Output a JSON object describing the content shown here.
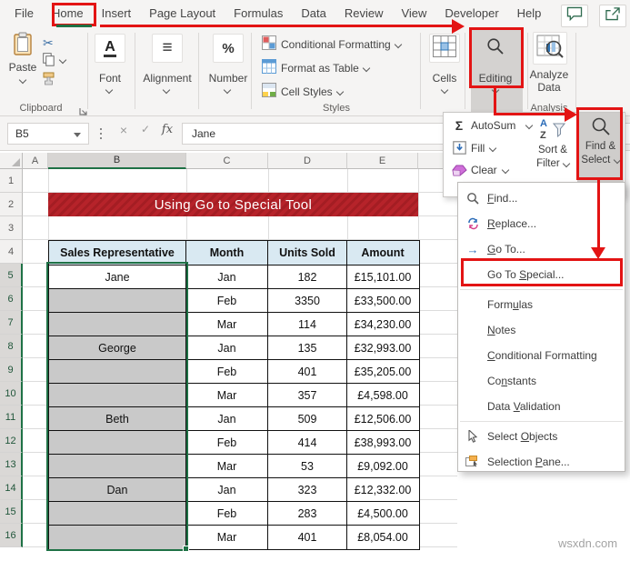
{
  "window": {
    "watermark": "wsxdn.com"
  },
  "tabs": {
    "items": [
      "File",
      "Home",
      "Insert",
      "Page Layout",
      "Formulas",
      "Data",
      "Review",
      "View",
      "Developer",
      "Help"
    ],
    "active": "Home"
  },
  "ribbon": {
    "clipboard": {
      "paste": "Paste",
      "label": "Clipboard"
    },
    "font": {
      "icon_letter": "A",
      "label": "Font"
    },
    "alignment": {
      "icon": "≡",
      "label": "Alignment"
    },
    "number": {
      "icon": "%",
      "label": "Number"
    },
    "styles": {
      "conditional": "Conditional Formatting",
      "format_table": "Format as Table",
      "cell_styles": "Cell Styles",
      "label": "Styles"
    },
    "cells": {
      "label": "Cells"
    },
    "editing": {
      "label": "Editing"
    },
    "analyze": {
      "line1": "Analyze",
      "line2": "Data",
      "group": "Analysis"
    }
  },
  "formula_bar": {
    "name_box": "B5",
    "cancel": "×",
    "enter": "✓",
    "fx": "fx",
    "value": "Jane"
  },
  "flyout": {
    "autosum": {
      "icon": "Σ",
      "label": "AutoSum"
    },
    "fill": {
      "label": "Fill"
    },
    "clear": {
      "label": "Clear"
    },
    "sort_filter": {
      "icon_a": "A",
      "icon_z": "Z",
      "line1": "Sort &",
      "line2": "Filter"
    },
    "find_select": {
      "line1": "Find &",
      "line2": "Select"
    }
  },
  "menu": {
    "items": [
      {
        "pre": "",
        "accel": "F",
        "post": "ind...",
        "icon": "find"
      },
      {
        "pre": "",
        "accel": "R",
        "post": "eplace...",
        "icon": "replace"
      },
      {
        "pre": "",
        "accel": "G",
        "post": "o To...",
        "icon": "goto"
      },
      {
        "pre": "Go To ",
        "accel": "S",
        "post": "pecial...",
        "icon": "",
        "highlight": true
      },
      {
        "sep": true
      },
      {
        "pre": "Form",
        "accel": "u",
        "post": "las",
        "icon": ""
      },
      {
        "pre": "",
        "accel": "N",
        "post": "otes",
        "icon": ""
      },
      {
        "pre": "",
        "accel": "C",
        "post": "onditional Formatting",
        "icon": ""
      },
      {
        "pre": "Co",
        "accel": "n",
        "post": "stants",
        "icon": ""
      },
      {
        "pre": "Data ",
        "accel": "V",
        "post": "alidation",
        "icon": ""
      },
      {
        "sep": true
      },
      {
        "pre": "Select ",
        "accel": "O",
        "post": "bjects",
        "icon": "cursor"
      },
      {
        "pre": "Selection ",
        "accel": "P",
        "post": "ane...",
        "icon": "pane"
      }
    ]
  },
  "sheet": {
    "columns": [
      "A",
      "B",
      "C",
      "D",
      "E"
    ],
    "rows": [
      "1",
      "2",
      "3",
      "4",
      "5",
      "6",
      "7",
      "8",
      "9",
      "10",
      "11",
      "12",
      "13",
      "14",
      "15",
      "16"
    ],
    "banner": "Using Go to Special Tool",
    "active_cell": "B5",
    "table": {
      "headers": [
        "Sales Representative",
        "Month",
        "Units Sold",
        "Amount"
      ],
      "rows": [
        [
          "Jane",
          "Jan",
          "182",
          "£15,101.00"
        ],
        [
          "",
          "Feb",
          "3350",
          "£33,500.00"
        ],
        [
          "",
          "Mar",
          "114",
          "£34,230.00"
        ],
        [
          "George",
          "Jan",
          "135",
          "£32,993.00"
        ],
        [
          "",
          "Feb",
          "401",
          "£35,205.00"
        ],
        [
          "",
          "Mar",
          "357",
          "£4,598.00"
        ],
        [
          "Beth",
          "Jan",
          "509",
          "£12,506.00"
        ],
        [
          "",
          "Feb",
          "414",
          "£38,993.00"
        ],
        [
          "",
          "Mar",
          "53",
          "£9,092.00"
        ],
        [
          "Dan",
          "Jan",
          "323",
          "£12,332.00"
        ],
        [
          "",
          "Feb",
          "283",
          "£4,500.00"
        ],
        [
          "",
          "Mar",
          "401",
          "£8,054.00"
        ]
      ]
    }
  },
  "colors": {
    "annotation_red": "#e31414",
    "banner_red": "#b6232a",
    "table_header_blue": "#d9e9f2",
    "excel_green": "#1e7145",
    "selection_grey": "#c9c9c9"
  }
}
